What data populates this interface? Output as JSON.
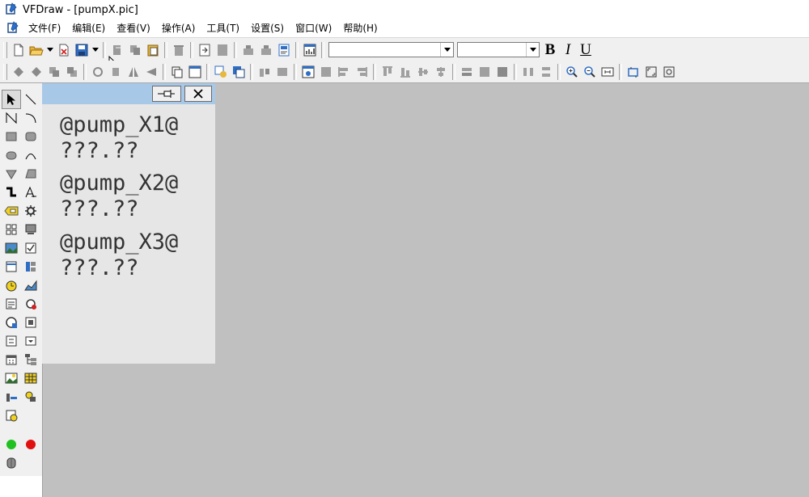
{
  "window": {
    "title": "VFDraw - [pumpX.pic]"
  },
  "menu": [
    {
      "label": "文件(F)"
    },
    {
      "label": "编辑(E)"
    },
    {
      "label": "查看(V)"
    },
    {
      "label": "操作(A)"
    },
    {
      "label": "工具(T)"
    },
    {
      "label": "设置(S)"
    },
    {
      "label": "窗口(W)"
    },
    {
      "label": "帮助(H)"
    }
  ],
  "format_bar": {
    "font_name": "",
    "font_size": "",
    "bold": "B",
    "italic": "I",
    "underline": "U"
  },
  "tag_window": {
    "lines": [
      "@pump_X1@",
      "???.??",
      "@pump_X2@",
      "???.??",
      "@pump_X3@",
      "???.??"
    ]
  },
  "colors": {
    "workspace": "#c0c0c0",
    "toolbar": "#f0f0f0",
    "title_bar": "#a8c8e8",
    "tag_text": "#333333"
  },
  "icons": {
    "toolbar1": [
      "new-icon",
      "open-icon",
      "dropdown-icon",
      "close-file-icon",
      "save-icon",
      "dropdown-icon",
      "align-left-icon",
      "copy-icon",
      "paste-icon",
      "delete-icon",
      "import-icon",
      "export-icon",
      "group-icon",
      "ungroup-icon",
      "properties-icon",
      "chart-icon"
    ],
    "toolbar2": [
      "bring-front-icon",
      "send-back-icon",
      "forward-icon",
      "backward-icon",
      "rotate-left-icon",
      "rotate-right-icon",
      "flip-horizontal-icon",
      "flip-vertical-icon",
      "window-icon",
      "panel-icon",
      "tag-icon",
      "layer-icon",
      "grid-icon",
      "align-icons",
      "zoom-in-icon",
      "zoom-out-icon",
      "fit-icon",
      "select-area-icon",
      "fullscreen-icon",
      "refresh-icon"
    ],
    "tools": [
      "pointer-icon",
      "line-icon",
      "polyline-icon",
      "arc-icon",
      "rectangle-icon",
      "rounded-rect-icon",
      "ellipse-icon",
      "curve-icon",
      "polygon-icon",
      "fill-shape-icon",
      "pipe-icon",
      "text-icon",
      "tag-icon",
      "gear-icon",
      "grid-icon",
      "monitor-icon",
      "image-icon",
      "checkbox-icon",
      "frame-icon",
      "panel-icon",
      "clock-icon",
      "trend-icon",
      "report-icon",
      "alarm-icon",
      "meter-icon",
      "recipe-icon",
      "dialog-icon",
      "dropdown-icon",
      "calendar-icon",
      "tree-icon",
      "picture-icon",
      "table-icon",
      "bar-icon",
      "link-icon",
      "log-icon",
      "green-light-icon",
      "red-light-icon",
      "cylinder-icon"
    ]
  }
}
